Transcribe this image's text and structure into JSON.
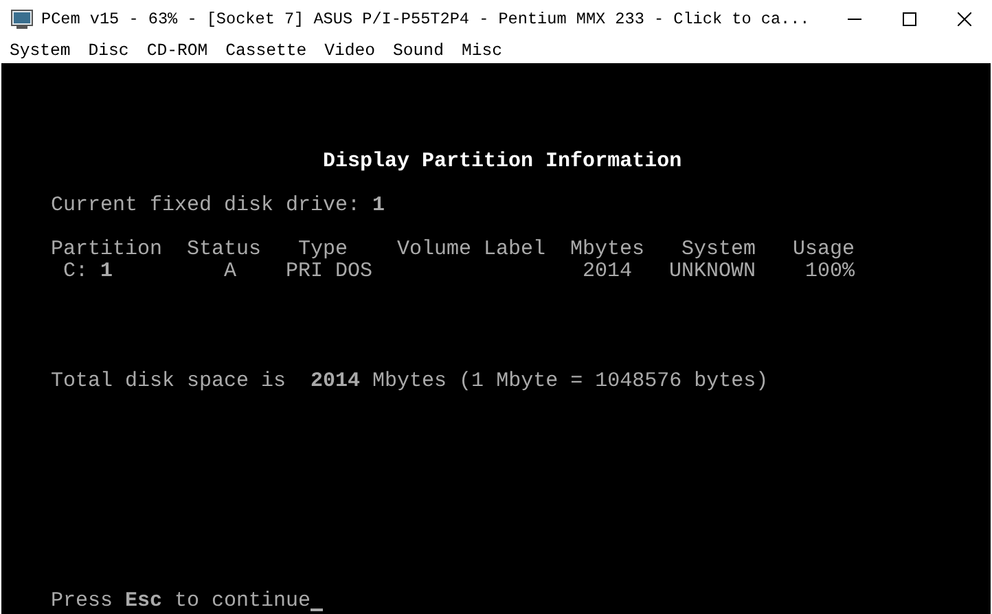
{
  "window": {
    "title": "PCem v15 - 63% - [Socket 7] ASUS P/I-P55T2P4 - Pentium MMX 233 - Click to ca..."
  },
  "menu": [
    "System",
    "Disc",
    "CD-ROM",
    "Cassette",
    "Video",
    "Sound",
    "Misc"
  ],
  "screen": {
    "heading": "Display Partition Information",
    "drive_line": "Current fixed disk drive: **1**",
    "table": {
      "columns": [
        "Partition",
        "Status",
        "Type",
        "Volume Label",
        "Mbytes",
        "System",
        "Usage"
      ],
      "rows": [
        [
          "C: **1**",
          "A",
          "PRI DOS",
          "",
          "2014",
          "UNKNOWN",
          "100%"
        ]
      ]
    },
    "total_line": "Total disk space is  **2014** Mbytes (1 Mbyte = 1048576 bytes)",
    "prompt": "Press **Esc** to continue"
  }
}
